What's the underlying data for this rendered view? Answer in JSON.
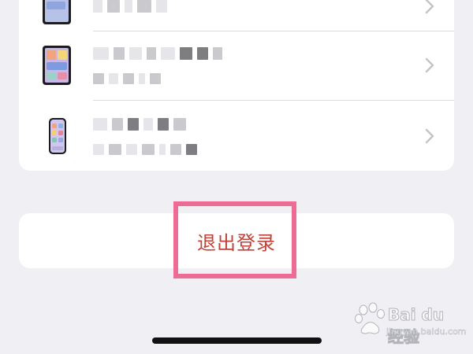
{
  "device_list": {
    "items": [
      {
        "icon": "ipad-icon",
        "name": "",
        "model": ""
      },
      {
        "icon": "ipad-icon",
        "name": "",
        "model": ""
      },
      {
        "icon": "iphone-icon",
        "name": "",
        "model": ""
      }
    ]
  },
  "sign_out": {
    "label": "退出登录",
    "color": "#c0433a"
  },
  "annotation": {
    "highlight_color": "#ee6b93"
  },
  "watermark": {
    "brand": "Bai du 经验",
    "site": "jingyan.baidu.com"
  },
  "colors": {
    "background": "#efeff4",
    "card": "#ffffff",
    "chevron": "#c4c4c8"
  }
}
